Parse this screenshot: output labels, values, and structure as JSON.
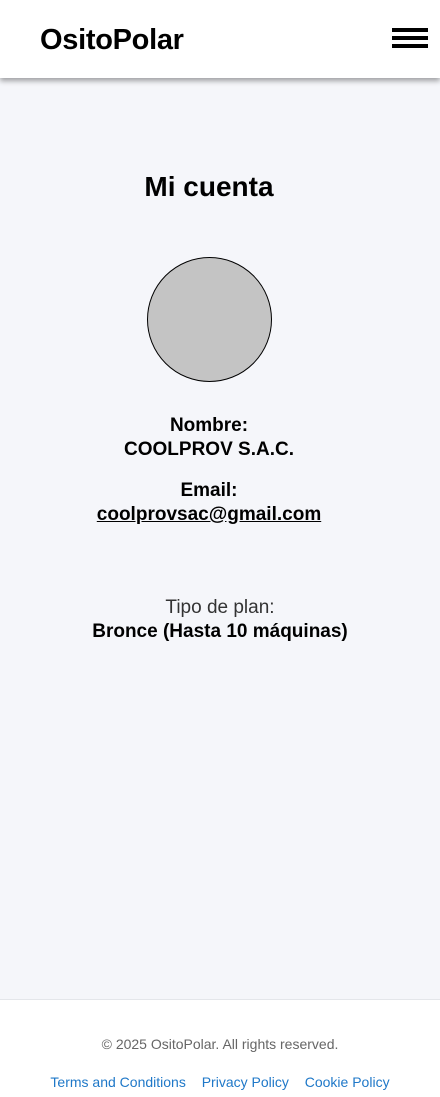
{
  "header": {
    "brand": "OsitoPolar",
    "menu_icon": "hamburger-icon"
  },
  "account": {
    "title": "Mi cuenta",
    "avatar_color": "#c4c4c4",
    "name_label": "Nombre:",
    "name_value": "COOLPROV S.A.C.",
    "email_label": "Email:",
    "email_value": "coolprovsac@gmail.com",
    "plan_label": "Tipo de plan:",
    "plan_value": "Bronce (Hasta 10 máquinas)"
  },
  "footer": {
    "copyright": "© 2025 OsitoPolar. All rights reserved.",
    "links": [
      "Terms and Conditions",
      "Privacy Policy",
      "Cookie Policy"
    ],
    "link_color": "#1f78c8"
  }
}
